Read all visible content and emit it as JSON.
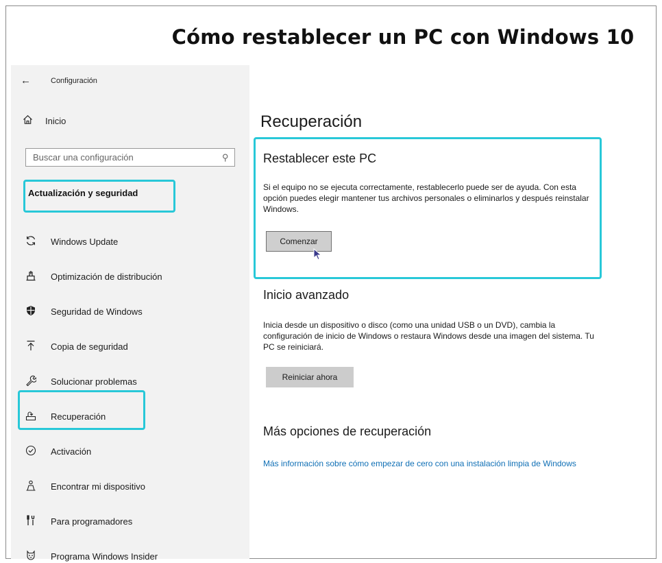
{
  "headline": "Cómo restablecer un PC con Windows 10",
  "accent_color": "#28c8d8",
  "link_color": "#0f6fb5",
  "sidebar": {
    "app_title": "Configuración",
    "home_label": "Inicio",
    "search_placeholder": "Buscar una configuración",
    "section_title": "Actualización y seguridad",
    "items": [
      {
        "label": "Windows Update",
        "icon": "sync-icon"
      },
      {
        "label": "Optimización de distribución",
        "icon": "delivery-icon"
      },
      {
        "label": "Seguridad de Windows",
        "icon": "shield-icon"
      },
      {
        "label": "Copia de seguridad",
        "icon": "backup-icon"
      },
      {
        "label": "Solucionar problemas",
        "icon": "wrench-icon"
      },
      {
        "label": "Recuperación",
        "icon": "recovery-icon"
      },
      {
        "label": "Activación",
        "icon": "check-circle-icon"
      },
      {
        "label": "Encontrar mi dispositivo",
        "icon": "person-location-icon"
      },
      {
        "label": "Para programadores",
        "icon": "developer-tools-icon"
      },
      {
        "label": "Programa Windows Insider",
        "icon": "insider-cat-icon"
      }
    ]
  },
  "main": {
    "title": "Recuperación",
    "reset": {
      "title": "Restablecer este PC",
      "description": "Si el equipo no se ejecuta correctamente, restablecerlo puede ser de ayuda. Con esta opción puedes elegir mantener tus archivos personales o eliminarlos y después reinstalar Windows.",
      "button": "Comenzar"
    },
    "advanced": {
      "title": "Inicio avanzado",
      "description": "Inicia desde un dispositivo o disco (como una unidad USB o un DVD), cambia la configuración de inicio de Windows o restaura Windows desde una imagen del sistema. Tu PC se reiniciará.",
      "button": "Reiniciar ahora"
    },
    "more": {
      "title": "Más opciones de recuperación",
      "link": "Más información sobre cómo empezar de cero con una instalación limpia de Windows"
    }
  }
}
